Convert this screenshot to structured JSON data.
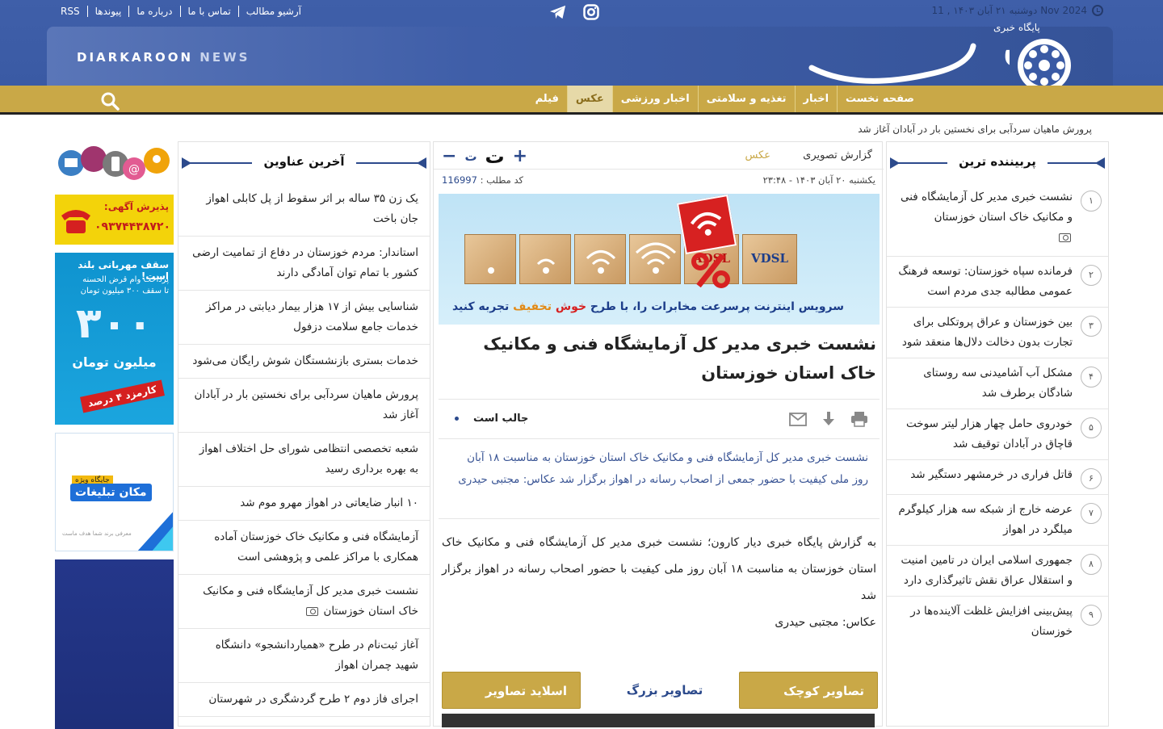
{
  "header": {
    "top_links": [
      "RSS",
      "پیوندها",
      "درباره ما",
      "تماس با ما",
      "آرشیو مطالب"
    ],
    "date": "دوشنبه ۲۱ آبان ۱۴۰۳ , 11 Nov 2024",
    "brand_en_1": "DIARKAROON",
    "brand_en_2": "NEWS",
    "logo_sub": "پایگاه خبری",
    "logo_main": "دیارکارون"
  },
  "nav": {
    "items": [
      "صفحه نخست",
      "اخبار",
      "تغذیه و سلامتی",
      "اخبار ورزشی",
      "عکس",
      "فیلم"
    ],
    "active": "عکس"
  },
  "ticker": "پرورش ماهیان سردآبی برای نخستین بار در آبادان آغاز شد",
  "popular": {
    "title": "پربیننده ترین",
    "items": [
      {
        "num": "۱",
        "text": "نشست خبری مدیر کل آزمایشگاه فنی و مکانیک خاک استان خوزستان"
      },
      {
        "num": "۲",
        "text": "فرمانده سپاه خوزستان: توسعه فرهنگ عمومی مطالبه جدی مردم است"
      },
      {
        "num": "۳",
        "text": "بین خوزستان و عراق پروتکلی برای تجارت بدون دخالت دلال‌ها منعقد شود"
      },
      {
        "num": "۴",
        "text": "مشکل آب آشامیدنی سه روستای شادگان برطرف شد"
      },
      {
        "num": "۵",
        "text": "خودروی حامل چهار هزار لیتر سوخت قاچاق در آبادان توقیف شد"
      },
      {
        "num": "۶",
        "text": "قاتل فراری در خرمشهر دستگیر شد"
      },
      {
        "num": "۷",
        "text": "عرضه خارج از شبکه سه هزار کیلوگرم میلگرد در اهواز"
      },
      {
        "num": "۸",
        "text": "جمهوری اسلامی ایران در تامین امنیت و استقلال عراق نقش تاثیرگذاری دارد"
      },
      {
        "num": "۹",
        "text": "پیش‌بینی افزایش غلظت آلاینده‌ها در خوزستان"
      }
    ]
  },
  "article": {
    "category": "گزارش تصویری",
    "subcategory": "عکس",
    "date": "یکشنبه ۲۰ آبان ۱۴۰۳ - ۲۳:۴۸",
    "code_label": "کد مطلب :",
    "code": "116997",
    "banner_text_a": "سرویس اینترنت پرسرعت مخابرات را، با طرح",
    "banner_text_b": "خوش",
    "banner_text_c": "تخفیف",
    "banner_text_d": "تجربه کنید",
    "banner_adsl": "ADSL",
    "banner_vdsl": "VDSL",
    "title": "نشست خبری مدیر کل آزمایشگاه فنی و مکانیک خاک استان خوزستان",
    "like": "جالب است",
    "lead": "نشست خبری مدیر کل آزمایشگاه فنی و مکانیک خاک استان خوزستان به مناسبت ۱۸ آبان روز ملی کیفیت با حضور جمعی از اصحاب رسانه در اهواز برگزار شد عکاس: مجتبی حیدری",
    "body_1": "به گزارش پایگاه خبری دیار کارون؛ نشست خبری مدیر کل آزمایشگاه فنی و مکانیک خاک استان خوزستان به مناسبت ۱۸ آبان روز ملی کیفیت با حضور اصحاب رسانه در اهواز برگزار شد",
    "body_2": "عکاس: مجتبی حیدری",
    "btn_small": "تصاویر کوچک",
    "btn_large": "تصاویر بزرگ",
    "btn_slide": "اسلاید تصاویر"
  },
  "latest": {
    "title": "آخرین عناوین",
    "items": [
      "یک زن ۳۵ ساله بر اثر سقوط از پل کابلی اهواز جان باخت",
      "استاندار: مردم خوزستان در دفاع از تمامیت ارضی کشور با تمام توان آمادگی دارند",
      "شناسایی بیش از ۱۷ هزار بیمار دیابتی در مراکز خدمات جامع سلامت دزفول",
      "خدمات بستری بازنشستگان شوش رایگان می‌شود",
      "پرورش ماهیان سردآبی برای نخستین بار در آبادان آغاز شد",
      "شعبه تخصصی انتظامی شورای حل اختلاف اهواز به بهره برداری رسید",
      "۱۰ انبار ضایعاتی در اهواز مهرو موم شد",
      "آزمایشگاه فنی و مکانیک خاک خوزستان آماده همکاری با مراکز علمی و پژوهشی است",
      "نشست خبری مدیر کل آزمایشگاه فنی و مکانیک خاک استان خوزستان",
      "آغاز ثبت‌نام در طرح «همیاردانشجو» دانشگاه شهید چمران اهواز",
      "اجرای فاز دوم ۲ طرح گردشگری در شهرستان"
    ]
  },
  "ads": {
    "ad2_line1": "پذیرش آگهی:",
    "ad2_line2": "۰۹۳۷۴۴۳۸۷۲۰",
    "ad3_line1": "سقف مهربانی بلند است!",
    "ad3_line2": "پرداخت وام قرض الحسنه",
    "ad3_line3": "تا سقف ۳۰۰ میلیون تومان",
    "ad3_big": "۳۰۰",
    "ad3_unit": "میلیون تومان",
    "ad3_badge": "کارمزد ۴ درصد",
    "ad4_tag": "جایگاه ویژه",
    "ad4_main": "مکان تبلیغات",
    "ad4_foot": "معرفی برند شما هدف ماست"
  }
}
